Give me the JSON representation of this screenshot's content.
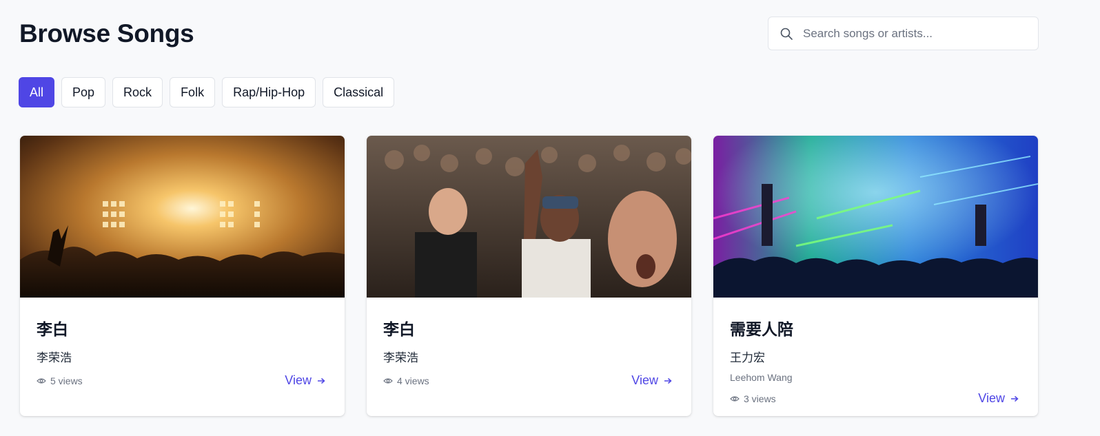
{
  "header": {
    "title": "Browse Songs",
    "search_placeholder": "Search songs or artists..."
  },
  "filters": [
    {
      "label": "All",
      "active": true
    },
    {
      "label": "Pop",
      "active": false
    },
    {
      "label": "Rock",
      "active": false
    },
    {
      "label": "Folk",
      "active": false
    },
    {
      "label": "Rap/Hip-Hop",
      "active": false
    },
    {
      "label": "Classical",
      "active": false
    }
  ],
  "songs": [
    {
      "title": "李白",
      "artist": "李荣浩",
      "artist_en": "",
      "views": "5 views",
      "view_label": "View",
      "image": "concert-stage-golden-lights"
    },
    {
      "title": "李白",
      "artist": "李荣浩",
      "artist_en": "",
      "views": "4 views",
      "view_label": "View",
      "image": "cheering-crowd"
    },
    {
      "title": "需要人陪",
      "artist": "王力宏",
      "artist_en": "Leehom Wang",
      "views": "3 views",
      "view_label": "View",
      "image": "festival-stage-colorful-lasers"
    }
  ],
  "colors": {
    "accent": "#4f46e5",
    "background": "#f8f9fb"
  },
  "icons": {
    "search": "search-icon",
    "views": "eye-icon",
    "view_link": "arrow-right-icon"
  }
}
